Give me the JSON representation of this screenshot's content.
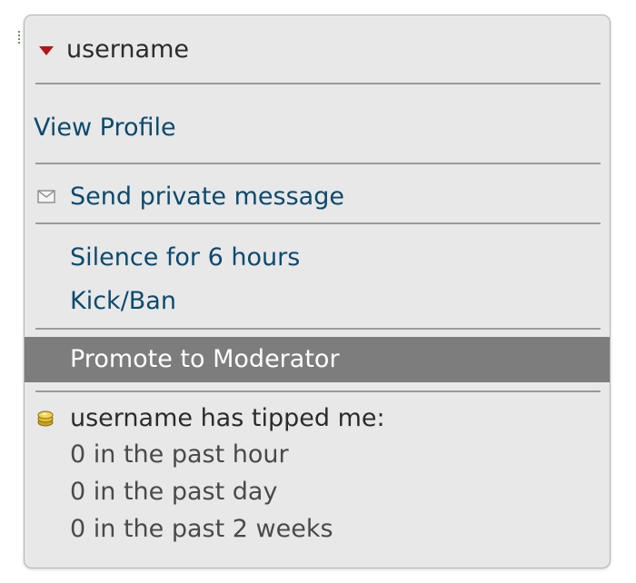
{
  "menu": {
    "header": {
      "username": "username",
      "icon": "caret-down-icon",
      "caret_color": "#b01818"
    },
    "items": {
      "view_profile": "View Profile",
      "send_pm": "Send private message",
      "silence": "Silence for 6 hours",
      "kick_ban": "Kick/Ban",
      "promote": "Promote to Moderator"
    },
    "icons": {
      "send_pm": "envelope-icon",
      "tips": "coin-icon"
    },
    "tips": {
      "title": "username has tipped me:",
      "past_hour": "0 in the past hour",
      "past_day": "0 in the past day",
      "past_2_weeks": "0 in the past 2 weeks"
    },
    "colors": {
      "link": "#0c4a6e",
      "panel_bg": "#e8e8e8",
      "highlight_bg": "#7d7d7d",
      "highlight_text": "#ffffff"
    }
  }
}
